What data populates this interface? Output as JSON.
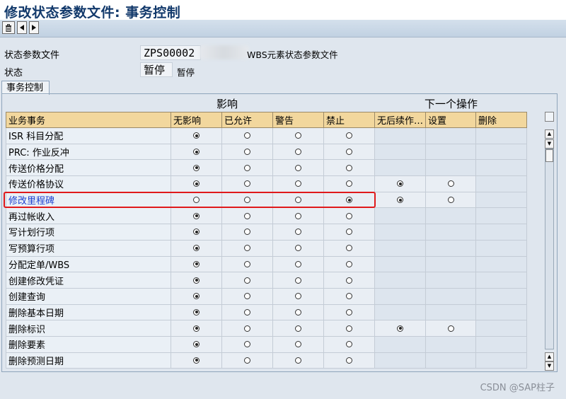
{
  "window": {
    "title": "修改状态参数文件: 事务控制"
  },
  "toolbar": {
    "buttons": [
      {
        "icon": "trash-icon",
        "glyph": "🗑"
      },
      {
        "icon": "arrow-left-icon",
        "glyph": "◀"
      },
      {
        "icon": "arrow-right-icon",
        "glyph": "▶"
      }
    ]
  },
  "header": {
    "profile_label": "状态参数文件",
    "profile_value": "ZPS00002",
    "profile_desc": "WBS元素状态参数文件",
    "status_label": "状态",
    "status_value": "暂停",
    "status_desc": "暂停"
  },
  "section": {
    "tab_label": "事务控制"
  },
  "groups": {
    "influence": "影响",
    "next_action": "下一个操作"
  },
  "table": {
    "columns": [
      "业务事务",
      "无影响",
      "已允许",
      "警告",
      "禁止",
      "无后续作…",
      "设置",
      "删除"
    ],
    "rows": [
      {
        "name": "ISR 科目分配",
        "influence": 0,
        "next": null
      },
      {
        "name": "PRC: 作业反冲",
        "influence": 0,
        "next": null
      },
      {
        "name": "传送价格分配",
        "influence": 0,
        "next": null
      },
      {
        "name": "传送价格协议",
        "influence": 0,
        "next": [
          0
        ]
      },
      {
        "name": "修改里程碑",
        "influence": 3,
        "next": [
          0
        ],
        "link": true
      },
      {
        "name": "再过帐收入",
        "influence": 0,
        "next": null
      },
      {
        "name": "写计划行项",
        "influence": 0,
        "next": null
      },
      {
        "name": "写预算行项",
        "influence": 0,
        "next": null
      },
      {
        "name": "分配定单/WBS",
        "influence": 0,
        "next": null
      },
      {
        "name": "创建修改凭证",
        "influence": 0,
        "next": null
      },
      {
        "name": "创建查询",
        "influence": 0,
        "next": null
      },
      {
        "name": "删除基本日期",
        "influence": 0,
        "next": null
      },
      {
        "name": "删除标识",
        "influence": 0,
        "next": [
          0
        ]
      },
      {
        "name": "删除要素",
        "influence": 0,
        "next": null
      },
      {
        "name": "删除预测日期",
        "influence": 0,
        "next": null
      }
    ]
  },
  "footer": {
    "watermark": "CSDN @SAP柱子"
  }
}
